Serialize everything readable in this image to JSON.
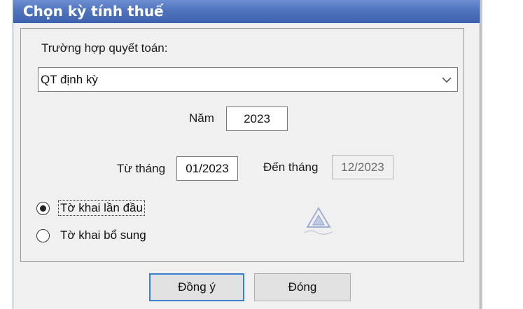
{
  "window": {
    "title": "Chọn kỳ tính thuế"
  },
  "settlement": {
    "label": "Trường hợp quyết toán:",
    "selected_value": "QT định kỳ"
  },
  "year": {
    "label": "Năm",
    "value": "2023"
  },
  "period": {
    "from_label": "Từ tháng",
    "from_value": "01/2023",
    "to_label": "Đến tháng",
    "to_value": "12/2023"
  },
  "declaration_type": {
    "options": [
      {
        "label": "Tờ khai lần đầu",
        "selected": true
      },
      {
        "label": "Tờ khai bổ sung",
        "selected": false
      }
    ]
  },
  "buttons": {
    "ok_label": "Đồng ý",
    "close_label": "Đóng"
  },
  "icons": {
    "dropdown": "chevron-down-icon",
    "watermark": "watermark-logo"
  }
}
